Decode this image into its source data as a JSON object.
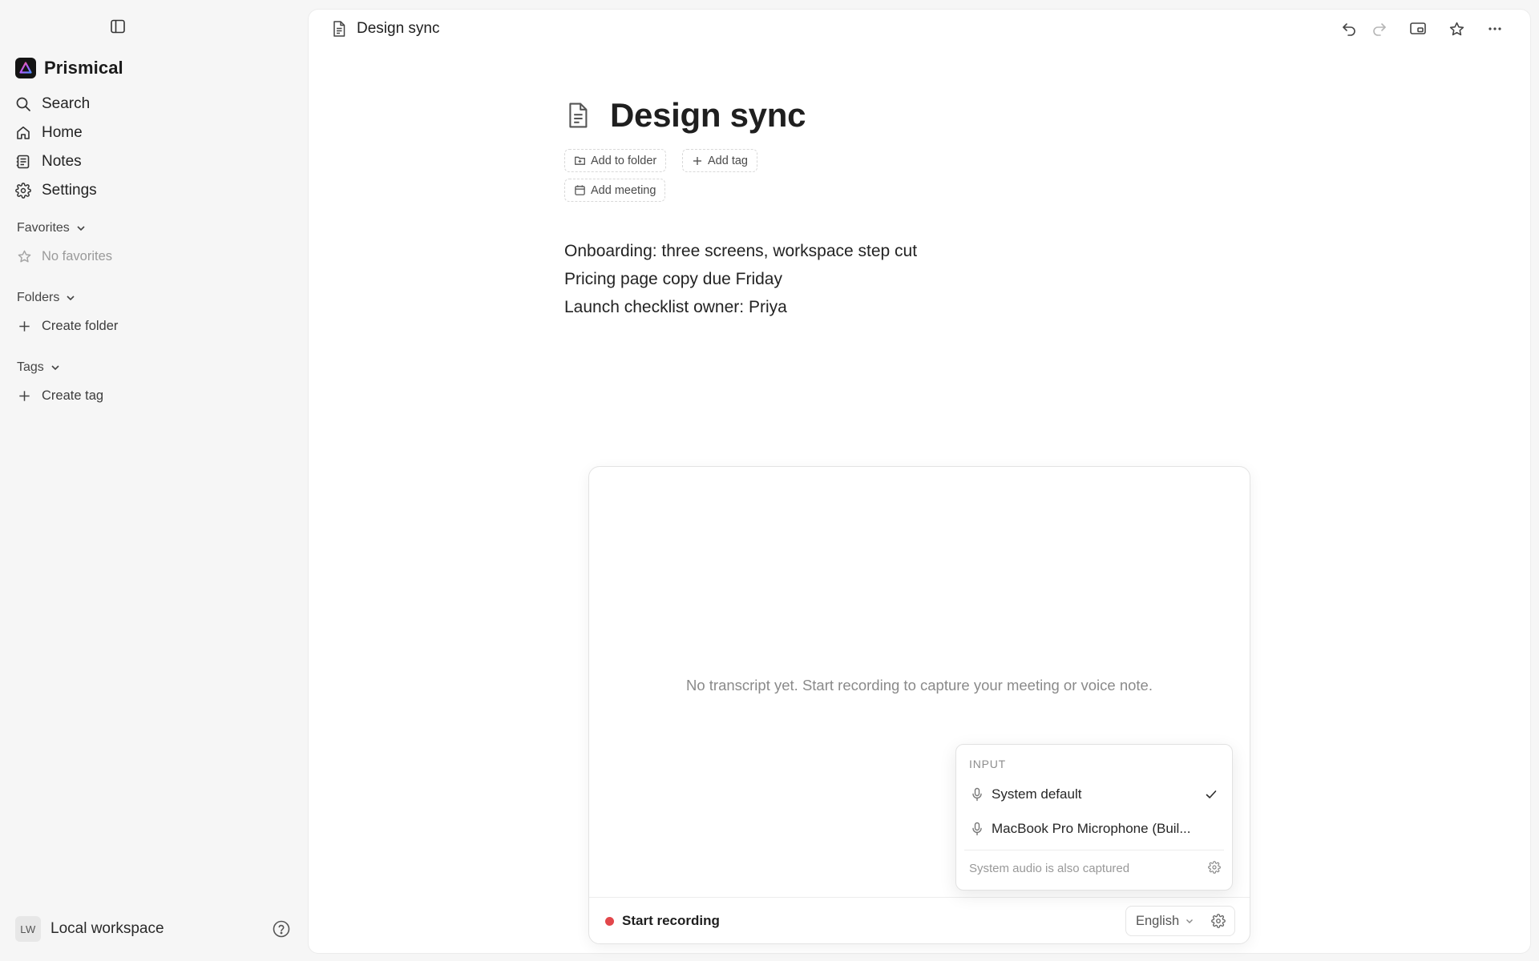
{
  "app": {
    "name": "Prismical"
  },
  "sidebar": {
    "nav": [
      {
        "label": "Search",
        "icon": "search-icon"
      },
      {
        "label": "Home",
        "icon": "home-icon"
      },
      {
        "label": "Notes",
        "icon": "notes-icon"
      },
      {
        "label": "Settings",
        "icon": "gear-icon"
      }
    ],
    "favorites": {
      "title": "Favorites",
      "empty": "No favorites"
    },
    "folders": {
      "title": "Folders",
      "create": "Create folder"
    },
    "tags": {
      "title": "Tags",
      "create": "Create tag"
    },
    "workspace": {
      "initials": "LW",
      "name": "Local workspace"
    }
  },
  "topbar": {
    "title": "Design sync",
    "actions": [
      "undo-icon",
      "redo-icon",
      "present-icon",
      "star-icon",
      "more-icon"
    ]
  },
  "document": {
    "title": "Design sync",
    "chips": {
      "folder": "Add to folder",
      "tag": "Add tag",
      "meeting": "Add meeting"
    },
    "lines": [
      "Onboarding: three screens, workspace step cut",
      "Pricing page copy due Friday",
      "Launch checklist owner: Priya"
    ]
  },
  "transcript": {
    "empty": "No transcript yet. Start recording to capture your meeting or voice note.",
    "record_label": "Start recording",
    "language": "English",
    "record_color": "#e2474b"
  },
  "input_menu": {
    "heading": "INPUT",
    "options": [
      {
        "label": "System default",
        "selected": true
      },
      {
        "label": "MacBook Pro Microphone (Buil...",
        "selected": false
      }
    ],
    "footnote": "System audio is also captured"
  }
}
